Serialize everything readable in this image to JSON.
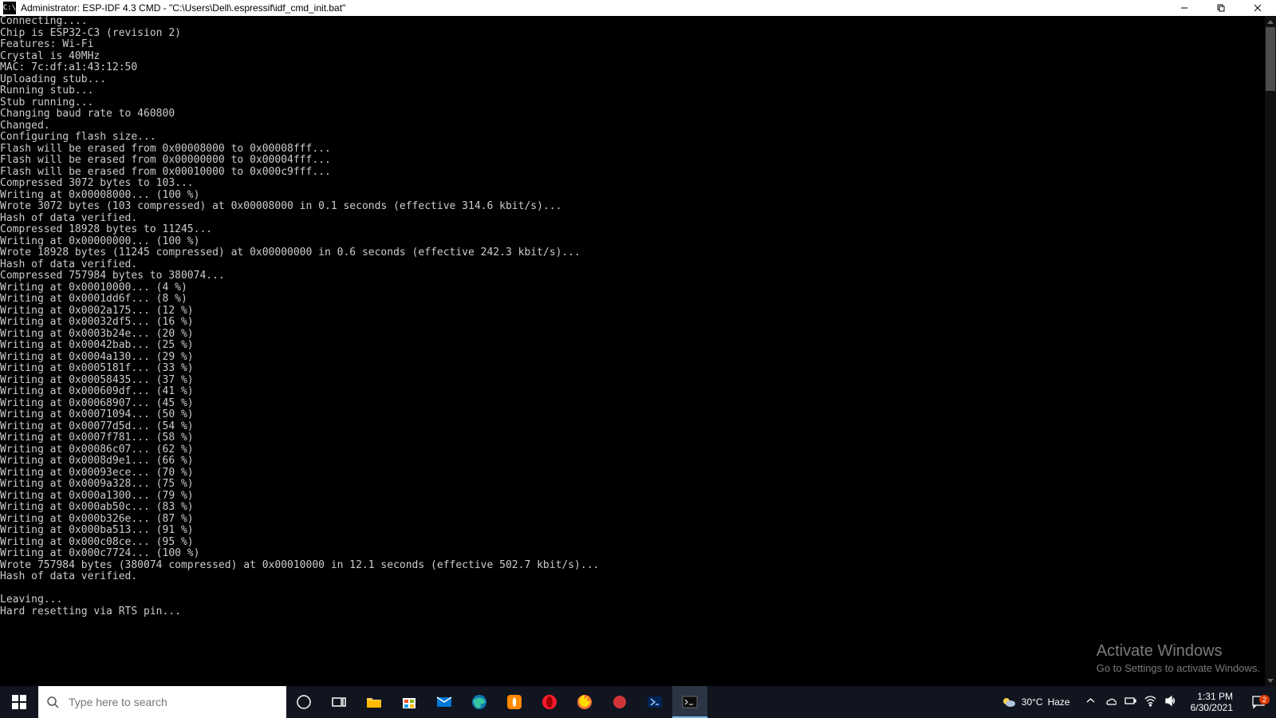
{
  "window": {
    "icon_text": "C:\\",
    "title": "Administrator: ESP-IDF 4.3 CMD - \"C:\\Users\\Dell\\.espressif\\idf_cmd_init.bat\""
  },
  "terminal": {
    "lines": [
      "Connecting....",
      "Chip is ESP32-C3 (revision 2)",
      "Features: Wi-Fi",
      "Crystal is 40MHz",
      "MAC: 7c:df:a1:43:12:50",
      "Uploading stub...",
      "Running stub...",
      "Stub running...",
      "Changing baud rate to 460800",
      "Changed.",
      "Configuring flash size...",
      "Flash will be erased from 0x00008000 to 0x00008fff...",
      "Flash will be erased from 0x00000000 to 0x00004fff...",
      "Flash will be erased from 0x00010000 to 0x000c9fff...",
      "Compressed 3072 bytes to 103...",
      "Writing at 0x00008000... (100 %)",
      "Wrote 3072 bytes (103 compressed) at 0x00008000 in 0.1 seconds (effective 314.6 kbit/s)...",
      "Hash of data verified.",
      "Compressed 18928 bytes to 11245...",
      "Writing at 0x00000000... (100 %)",
      "Wrote 18928 bytes (11245 compressed) at 0x00000000 in 0.6 seconds (effective 242.3 kbit/s)...",
      "Hash of data verified.",
      "Compressed 757984 bytes to 380074...",
      "Writing at 0x00010000... (4 %)",
      "Writing at 0x0001dd6f... (8 %)",
      "Writing at 0x0002a175... (12 %)",
      "Writing at 0x00032df5... (16 %)",
      "Writing at 0x0003b24e... (20 %)",
      "Writing at 0x00042bab... (25 %)",
      "Writing at 0x0004a130... (29 %)",
      "Writing at 0x0005181f... (33 %)",
      "Writing at 0x00058435... (37 %)",
      "Writing at 0x000609df... (41 %)",
      "Writing at 0x00068907... (45 %)",
      "Writing at 0x00071094... (50 %)",
      "Writing at 0x00077d5d... (54 %)",
      "Writing at 0x0007f781... (58 %)",
      "Writing at 0x00086c07... (62 %)",
      "Writing at 0x0008d9e1... (66 %)",
      "Writing at 0x00093ece... (70 %)",
      "Writing at 0x0009a328... (75 %)",
      "Writing at 0x000a1300... (79 %)",
      "Writing at 0x000ab50c... (83 %)",
      "Writing at 0x000b326e... (87 %)",
      "Writing at 0x000ba513... (91 %)",
      "Writing at 0x000c08ce... (95 %)",
      "Writing at 0x000c7724... (100 %)",
      "Wrote 757984 bytes (380074 compressed) at 0x00010000 in 12.1 seconds (effective 502.7 kbit/s)...",
      "Hash of data verified.",
      "",
      "Leaving...",
      "Hard resetting via RTS pin..."
    ]
  },
  "watermark": {
    "line1": "Activate Windows",
    "line2": "Go to Settings to activate Windows."
  },
  "taskbar": {
    "search_placeholder": "Type here to search",
    "weather": {
      "temp": "30°C",
      "cond": "Haze"
    },
    "clock": {
      "time": "1:31 PM",
      "date": "6/30/2021"
    },
    "notif_count": "2"
  }
}
